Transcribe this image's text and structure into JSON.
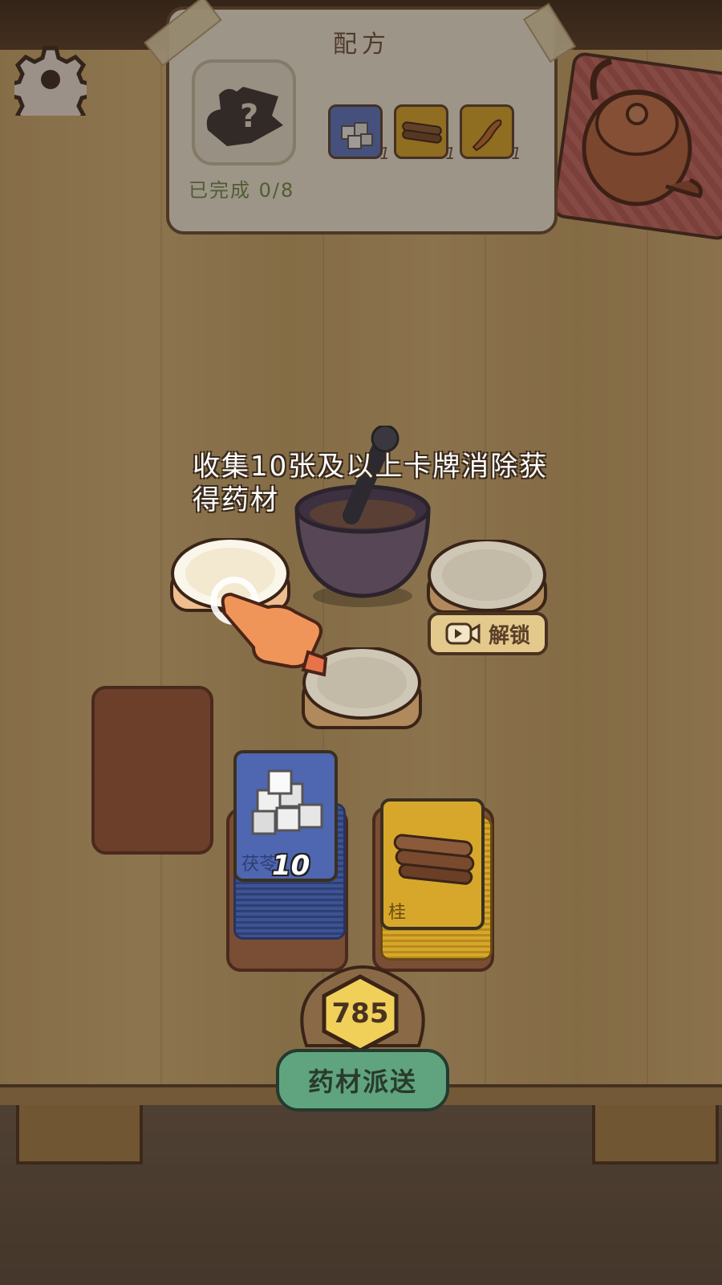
{
  "recipe": {
    "title": "配方",
    "progress": "已完成 0/8",
    "mystery_symbol": "?",
    "ingredients": [
      {
        "icon": "sugar-cubes-icon",
        "count": "1",
        "color": "#5a78c8"
      },
      {
        "icon": "cinnamon-bark-icon",
        "count": "1",
        "color": "#d9a72b"
      },
      {
        "icon": "ginseng-root-icon",
        "count": "1",
        "color": "#d9a72b"
      }
    ]
  },
  "tutorial": {
    "hint": "收集10张及以上卡牌消除获得药材"
  },
  "unlock": {
    "label": "解锁",
    "icon": "video-icon"
  },
  "cards": {
    "blue": {
      "label": "茯苓",
      "count": "10",
      "color": "#4f66b0",
      "icon": "sugar-cubes-icon"
    },
    "yellow": {
      "label": "桂",
      "color": "#d6a72b",
      "icon": "cinnamon-bark-icon"
    }
  },
  "coins": {
    "value": "785"
  },
  "deliver": {
    "label": "药材派送"
  }
}
